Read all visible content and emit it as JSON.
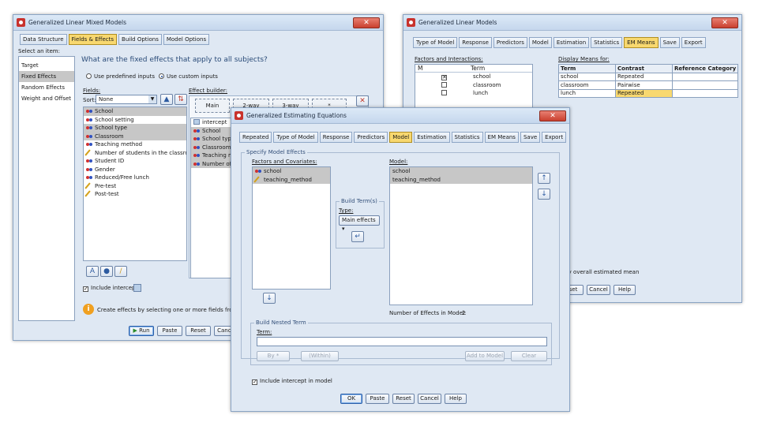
{
  "glmm": {
    "title": "Generalized Linear Mixed Models",
    "tabs": [
      "Data Structure",
      "Fields & Effects",
      "Build Options",
      "Model Options"
    ],
    "select_item_label": "Select an item:",
    "nav_items": [
      "Target",
      "Fixed Effects",
      "Random Effects",
      "Weight and Offset"
    ],
    "question": "What are the fixed effects that apply to all subjects?",
    "radio_predefined": "Use predefined inputs",
    "radio_custom": "Use custom inputs",
    "fields_label": "Fields:",
    "sort_label": "Sort:",
    "sort_value": "None",
    "fields": [
      {
        "label": "School",
        "icon": "nominal",
        "sel": true
      },
      {
        "label": "School setting",
        "icon": "nominal",
        "sel": false
      },
      {
        "label": "School type",
        "icon": "nominal",
        "sel": true
      },
      {
        "label": "Classroom",
        "icon": "nominal",
        "sel": true
      },
      {
        "label": "Teaching method",
        "icon": "nominal",
        "sel": false
      },
      {
        "label": "Number of students in the classro...",
        "icon": "scale",
        "sel": false
      },
      {
        "label": "Student ID",
        "icon": "nominal",
        "sel": false
      },
      {
        "label": "Gender",
        "icon": "nominal",
        "sel": false
      },
      {
        "label": "Reduced/Free lunch",
        "icon": "nominal",
        "sel": false
      },
      {
        "label": "Pre-test",
        "icon": "scale",
        "sel": false
      },
      {
        "label": "Post-test",
        "icon": "scale",
        "sel": false
      }
    ],
    "effect_builder_label": "Effect builder:",
    "builder_cols": [
      "Main",
      "2-way",
      "3-way",
      "*"
    ],
    "effects": [
      "intercept",
      "School",
      "School type",
      "Classroom",
      "Teaching m",
      "Number of"
    ],
    "include_intercept": "Include intercept",
    "info_text": "Create effects by selecting one or more fields from the",
    "buttons": {
      "run": "Run",
      "paste": "Paste",
      "reset": "Reset",
      "cancel": "Cance"
    }
  },
  "glm": {
    "title": "Generalized Linear Models",
    "tabs": [
      "Type of Model",
      "Response",
      "Predictors",
      "Model",
      "Estimation",
      "Statistics",
      "EM Means",
      "Save",
      "Export"
    ],
    "factors_label": "Factors and Interactions:",
    "col_m": "M",
    "col_term": "Term",
    "factor_rows": [
      {
        "term": "school",
        "checked": true
      },
      {
        "term": "classroom",
        "checked": false
      },
      {
        "term": "lunch",
        "checked": false
      }
    ],
    "display_means_label": "Display Means for:",
    "means_headers": [
      "Term",
      "Contrast",
      "Reference Category"
    ],
    "means_rows": [
      {
        "term": "school",
        "contrast": "Repeated",
        "ref": "",
        "hl": false
      },
      {
        "term": "classroom",
        "contrast": "Pairwise",
        "ref": "",
        "hl": false
      },
      {
        "term": "lunch",
        "contrast": "Repeated",
        "ref": "",
        "hl": true
      }
    ],
    "overall_mean_text": "play overall estimated mean",
    "buttons": {
      "reset": "set",
      "cancel": "Cancel",
      "help": "Help"
    }
  },
  "gee": {
    "title": "Generalized Estimating Equations",
    "tabs": [
      "Repeated",
      "Type of Model",
      "Response",
      "Predictors",
      "Model",
      "Estimation",
      "Statistics",
      "EM Means",
      "Save",
      "Export"
    ],
    "specify_label": "Specify Model Effects",
    "factors_label": "Factors and Covariates:",
    "factors": [
      {
        "label": "school",
        "icon": "nominal"
      },
      {
        "label": "teaching_method",
        "icon": "scale"
      }
    ],
    "build_terms_label": "Build Term(s)",
    "type_label": "Type:",
    "type_value": "Main effects",
    "model_label": "Model:",
    "model_terms": [
      "school",
      "teaching_method"
    ],
    "num_effects_label": "Number of Effects in Model:",
    "num_effects": "2",
    "nested_label": "Build Nested Term",
    "term_label": "Term:",
    "nested_buttons": {
      "by": "By *",
      "within": "(Within)",
      "add": "Add to Model",
      "clear": "Clear"
    },
    "include_intercept": "Include intercept in model",
    "buttons": {
      "ok": "OK",
      "paste": "Paste",
      "reset": "Reset",
      "cancel": "Cancel",
      "help": "Help"
    }
  }
}
